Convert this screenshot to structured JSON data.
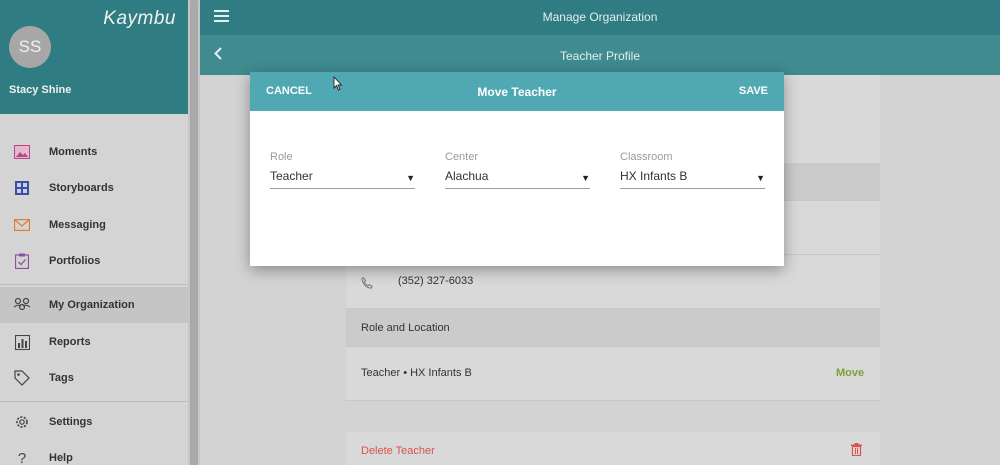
{
  "sidebar": {
    "brand": "Kaymbu",
    "avatar_initials": "SS",
    "user_name": "Stacy Shine",
    "items": [
      {
        "label": "Moments",
        "icon": "image-icon"
      },
      {
        "label": "Storyboards",
        "icon": "storyboard-icon"
      },
      {
        "label": "Messaging",
        "icon": "envelope-icon"
      },
      {
        "label": "Portfolios",
        "icon": "clipboard-check-icon"
      },
      {
        "label": "My Organization",
        "icon": "organization-icon"
      },
      {
        "label": "Reports",
        "icon": "bar-chart-icon"
      },
      {
        "label": "Tags",
        "icon": "tag-icon"
      },
      {
        "label": "Settings",
        "icon": "gear-icon"
      },
      {
        "label": "Help",
        "icon": "help-icon"
      }
    ]
  },
  "header": {
    "title": "Manage Organization",
    "subtitle": "Teacher Profile"
  },
  "profile": {
    "phone": "(352) 327-6033",
    "section_role_location": "Role and Location",
    "role_location_value": "Teacher • HX Infants B",
    "move_label": "Move",
    "delete_label": "Delete Teacher"
  },
  "modal": {
    "cancel_label": "CANCEL",
    "title": "Move Teacher",
    "save_label": "SAVE",
    "fields": {
      "role": {
        "label": "Role",
        "value": "Teacher"
      },
      "center": {
        "label": "Center",
        "value": "Alachua"
      },
      "classroom": {
        "label": "Classroom",
        "value": "HX Infants B"
      }
    }
  },
  "colors": {
    "topbar": "#2f7d82",
    "modal_header": "#50a8b2",
    "move_green": "#7da13a",
    "delete_red": "#d9534f"
  }
}
